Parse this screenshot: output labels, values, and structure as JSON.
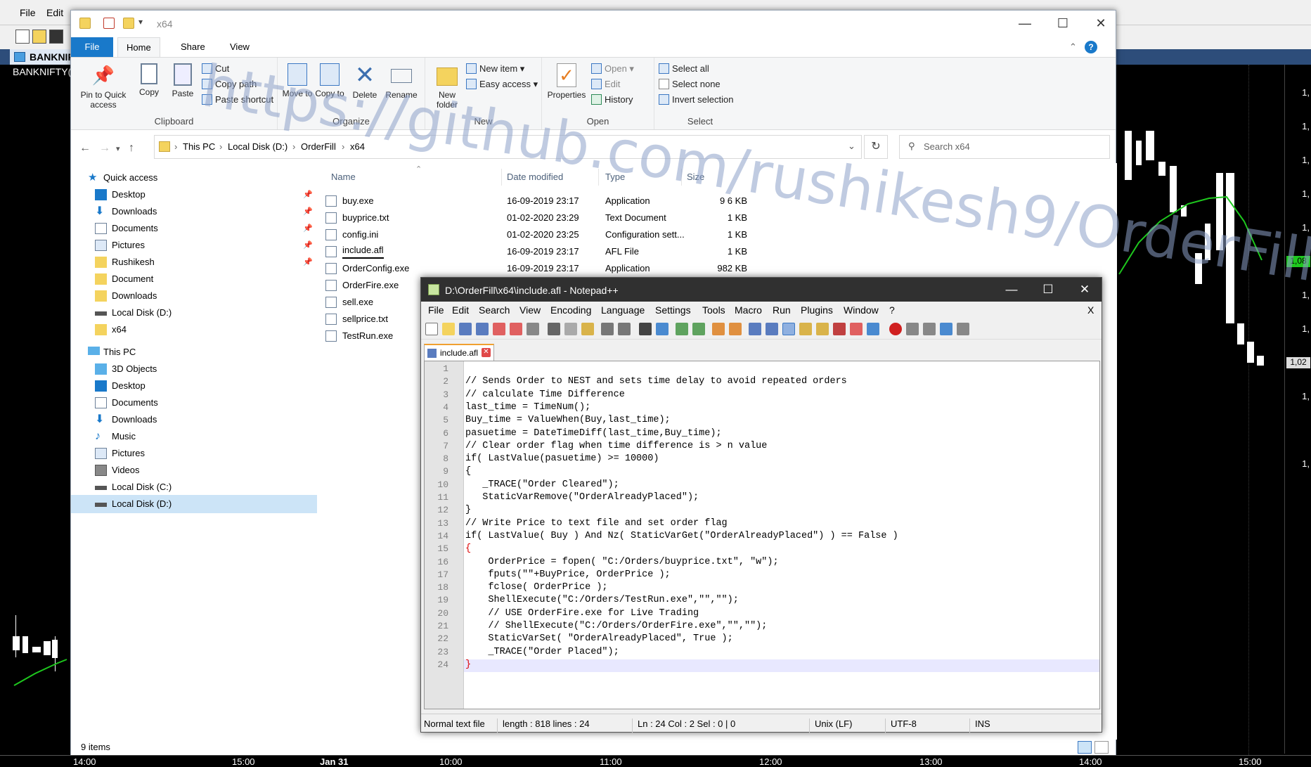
{
  "bg_app": {
    "menu": [
      "File",
      "Edit"
    ],
    "chart_tab": "BANKNIF",
    "chart_title": "BANKNIFTY(",
    "y_labels": [
      "1,",
      "1,",
      "1,",
      "1,",
      "1,",
      "1,",
      "1,",
      "1,",
      "1,",
      "1,"
    ],
    "y_price_green": "1,08",
    "y_price_last": "1,02",
    "x_labels": [
      "14:00",
      "15:00",
      "Jan 31",
      "10:00",
      "11:00",
      "12:00",
      "13:00",
      "14:00",
      "15:00"
    ]
  },
  "explorer": {
    "title": "x64",
    "tabs": [
      "File",
      "Home",
      "Share",
      "View"
    ],
    "ribbon": {
      "clipboard": {
        "label": "Clipboard",
        "pin": "Pin to Quick access",
        "copy": "Copy",
        "paste": "Paste",
        "cut": "Cut",
        "copy_path": "Copy path",
        "paste_shortcut": "Paste shortcut"
      },
      "organize": {
        "label": "Organize",
        "move_to": "Move to",
        "copy_to": "Copy to",
        "delete": "Delete",
        "rename": "Rename"
      },
      "new": {
        "label": "New",
        "new_item": "New item",
        "easy_access": "Easy access",
        "new_folder": "New folder"
      },
      "open": {
        "label": "Open",
        "properties": "Properties",
        "open": "Open",
        "edit": "Edit",
        "history": "History"
      },
      "select": {
        "label": "Select",
        "select_all": "Select all",
        "select_none": "Select none",
        "invert": "Invert selection"
      }
    },
    "address": {
      "crumbs": [
        "This PC",
        "Local Disk (D:)",
        "OrderFill",
        "x64"
      ]
    },
    "search_placeholder": "Search x64",
    "nav": [
      {
        "label": "Quick access",
        "pinned": false
      },
      {
        "label": "Desktop",
        "pinned": true
      },
      {
        "label": "Downloads",
        "pinned": true
      },
      {
        "label": "Documents",
        "pinned": true
      },
      {
        "label": "Pictures",
        "pinned": true
      },
      {
        "label": "Rushikesh",
        "pinned": true
      },
      {
        "label": "Document",
        "pinned": false
      },
      {
        "label": "Downloads",
        "pinned": false
      },
      {
        "label": "Local Disk (D:)",
        "pinned": false
      },
      {
        "label": "x64",
        "pinned": false
      },
      {
        "label": "This PC",
        "pinned": false
      },
      {
        "label": "3D Objects",
        "pinned": false
      },
      {
        "label": "Desktop",
        "pinned": false
      },
      {
        "label": "Documents",
        "pinned": false
      },
      {
        "label": "Downloads",
        "pinned": false
      },
      {
        "label": "Music",
        "pinned": false
      },
      {
        "label": "Pictures",
        "pinned": false
      },
      {
        "label": "Videos",
        "pinned": false
      },
      {
        "label": "Local Disk (C:)",
        "pinned": false
      },
      {
        "label": "Local Disk (D:)",
        "pinned": false
      }
    ],
    "columns": [
      "Name",
      "Date modified",
      "Type",
      "Size"
    ],
    "files": [
      {
        "name": "buy.exe",
        "date": "16-09-2019 23:17",
        "type": "Application",
        "size": "9 6 KB"
      },
      {
        "name": "buyprice.txt",
        "date": "01-02-2020 23:29",
        "type": "Text Document",
        "size": "1 KB"
      },
      {
        "name": "config.ini",
        "date": "01-02-2020 23:25",
        "type": "Configuration sett...",
        "size": "1 KB"
      },
      {
        "name": "include.afl",
        "date": "16-09-2019 23:17",
        "type": "AFL File",
        "size": "1 KB"
      },
      {
        "name": "OrderConfig.exe",
        "date": "16-09-2019 23:17",
        "type": "Application",
        "size": "982 KB"
      },
      {
        "name": "OrderFire.exe",
        "date": "",
        "type": "",
        "size": ""
      },
      {
        "name": "sell.exe",
        "date": "",
        "type": "",
        "size": ""
      },
      {
        "name": "sellprice.txt",
        "date": "",
        "type": "",
        "size": ""
      },
      {
        "name": "TestRun.exe",
        "date": "",
        "type": "",
        "size": ""
      }
    ],
    "status": "9 items",
    "watermark": "https://github.com/rushikesh9/OrderFill"
  },
  "npp": {
    "title": "D:\\OrderFill\\x64\\include.afl - Notepad++",
    "menu": [
      "File",
      "Edit",
      "Search",
      "View",
      "Encoding",
      "Language",
      "Settings",
      "Tools",
      "Macro",
      "Run",
      "Plugins",
      "Window",
      "?"
    ],
    "menu_close": "X",
    "tab": "include.afl",
    "lines": [
      "",
      "// Sends Order to NEST and sets time delay to avoid repeated orders",
      "// calculate Time Difference",
      "last_time = TimeNum();",
      "Buy_time = ValueWhen(Buy,last_time);",
      "pasuetime = DateTimeDiff(last_time,Buy_time);",
      "// Clear order flag when time difference is > n value",
      "if( LastValue(pasuetime) >= 10000)",
      "{",
      "   _TRACE(\"Order Cleared\");",
      "   StaticVarRemove(\"OrderAlreadyPlaced\");",
      "}",
      "// Write Price to text file and set order flag",
      "if( LastValue( Buy ) And Nz( StaticVarGet(\"OrderAlreadyPlaced\") ) == False )",
      "{",
      "    OrderPrice = fopen( \"C:/Orders/buyprice.txt\", \"w\");",
      "    fputs(\"\"+BuyPrice, OrderPrice );",
      "    fclose( OrderPrice );",
      "    ShellExecute(\"C:/Orders/TestRun.exe\",\"\",\"\");",
      "    // USE OrderFire.exe for Live Trading",
      "    // ShellExecute(\"C:/Orders/OrderFire.exe\",\"\",\"\");",
      "    StaticVarSet( \"OrderAlreadyPlaced\", True );",
      "    _TRACE(\"Order Placed\");",
      "}"
    ],
    "status": {
      "type": "Normal text file",
      "length": "length : 818    lines : 24",
      "pos": "Ln : 24    Col : 2    Sel : 0 | 0",
      "eol": "Unix (LF)",
      "enc": "UTF-8",
      "mode": "INS"
    }
  }
}
